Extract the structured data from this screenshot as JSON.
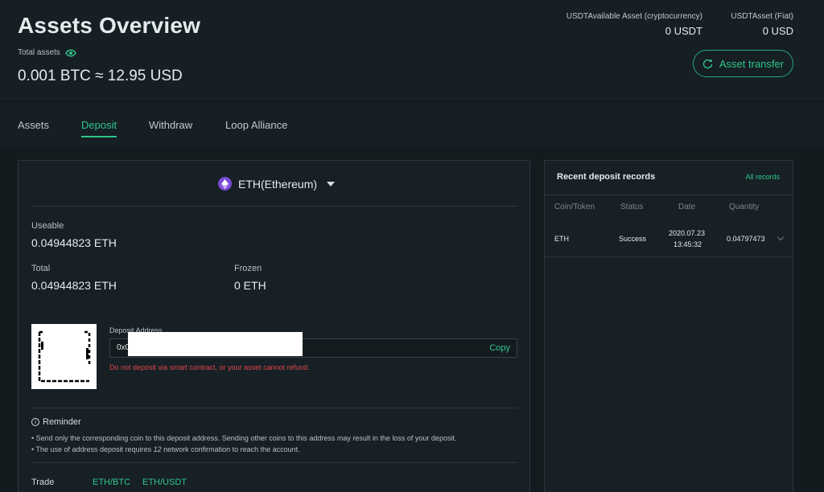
{
  "header": {
    "title": "Assets Overview",
    "total_label": "Total assets",
    "total_value": "0.001 BTC ≈ 12.95 USD",
    "crypto_label": "USDTAvailable Asset (cryptocurrency)",
    "crypto_value": "0 USDT",
    "fiat_label": "USDTAsset (Fiat)",
    "fiat_value": "0 USD",
    "transfer_label": "Asset transfer"
  },
  "tabs": [
    {
      "label": "Assets"
    },
    {
      "label": "Deposit"
    },
    {
      "label": "Withdraw"
    },
    {
      "label": "Loop Alliance"
    }
  ],
  "deposit": {
    "coin": "ETH",
    "coin_full": "(Ethereum)",
    "useable_label": "Useable",
    "useable_value": "0.04944823 ETH",
    "total_label": "Total",
    "total_value": "0.04944823 ETH",
    "frozen_label": "Frozen",
    "frozen_value": "0 ETH",
    "address_label": "Deposit Address",
    "address_value": "0x0",
    "copy_label": "Copy",
    "warning": "Do not deposit via smart contract, or your asset cannot refund.",
    "reminder_title": "Reminder",
    "reminder_1": "• Send only the corresponding coin to this deposit address. Sending other coins to this address may result in the loss of your deposit.",
    "reminder_2_a": "• The use of address deposit requires ",
    "reminder_2_num": "12",
    "reminder_2_b": " network confirmation to reach the account.",
    "trade_label": "Trade",
    "trade_links": [
      "ETH/BTC",
      "ETH/USDT"
    ]
  },
  "records": {
    "title": "Recent deposit records",
    "all_label": "All records",
    "columns": [
      "Coin/Token",
      "Status",
      "Date",
      "Quantity"
    ],
    "rows": [
      {
        "coin": "ETH",
        "status": "Success",
        "date": "2020.07.23",
        "time": "13:45:32",
        "quantity": "0.04797473"
      }
    ]
  },
  "colors": {
    "accent": "#2fc58c",
    "warning": "#e0474c",
    "eth": "#7b4bd6"
  }
}
